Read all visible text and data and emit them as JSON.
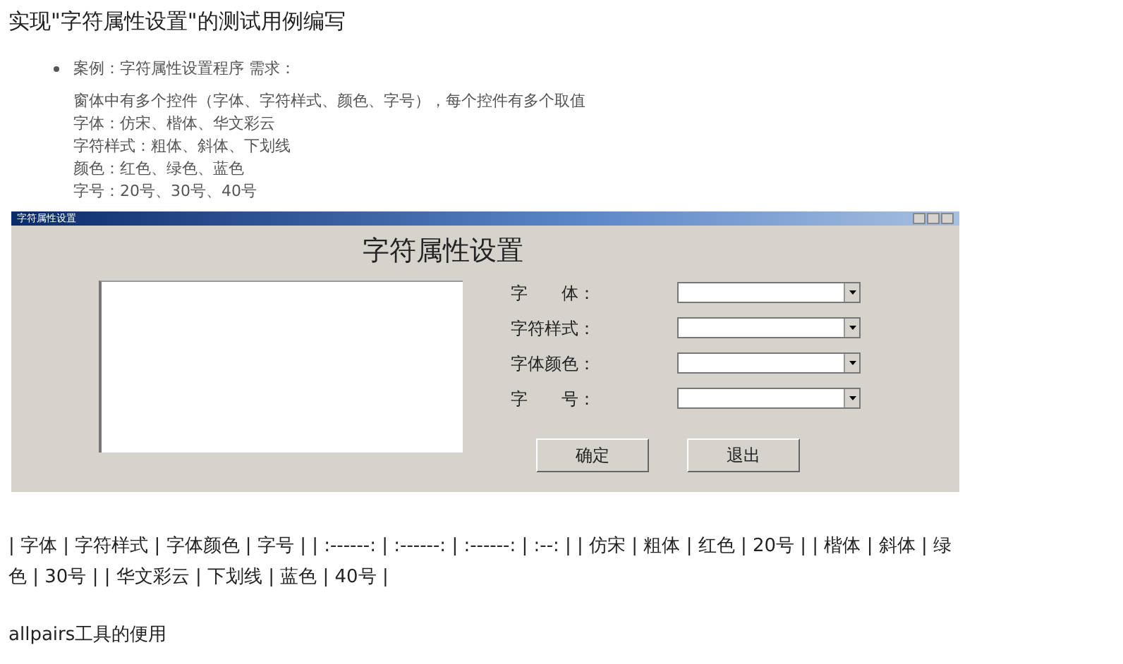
{
  "title": "实现\"字符属性设置\"的测试用例编写",
  "case_item": "案例：字符属性设置程序 需求：",
  "requirements": [
    "窗体中有多个控件（字体、字符样式、颜色、字号），每个控件有多个取值",
    "字体：仿宋、楷体、华文彩云",
    "字符样式：粗体、斜体、下划线",
    "颜色：红色、绿色、蓝色",
    "字号：20号、30号、40号"
  ],
  "dialog": {
    "title": "字符属性设置",
    "heading": "字符属性设置",
    "fields": [
      {
        "label": "字　　体："
      },
      {
        "label": "字符样式："
      },
      {
        "label": "字体颜色："
      },
      {
        "label": "字　　号："
      }
    ],
    "buttons": [
      "确定",
      "退出"
    ]
  },
  "table_text": "| 字体 | 字符样式 | 字体颜色 | 字号 | | :------: | :------: | :------: | :--: | | 仿宋 | 粗体 | 红色 | 20号 | | 楷体 | 斜体 | 绿色 | 30号 | | 华文彩云 | 下划线 | 蓝色 | 40号 |",
  "section_heading": "allpairs工具的便用"
}
